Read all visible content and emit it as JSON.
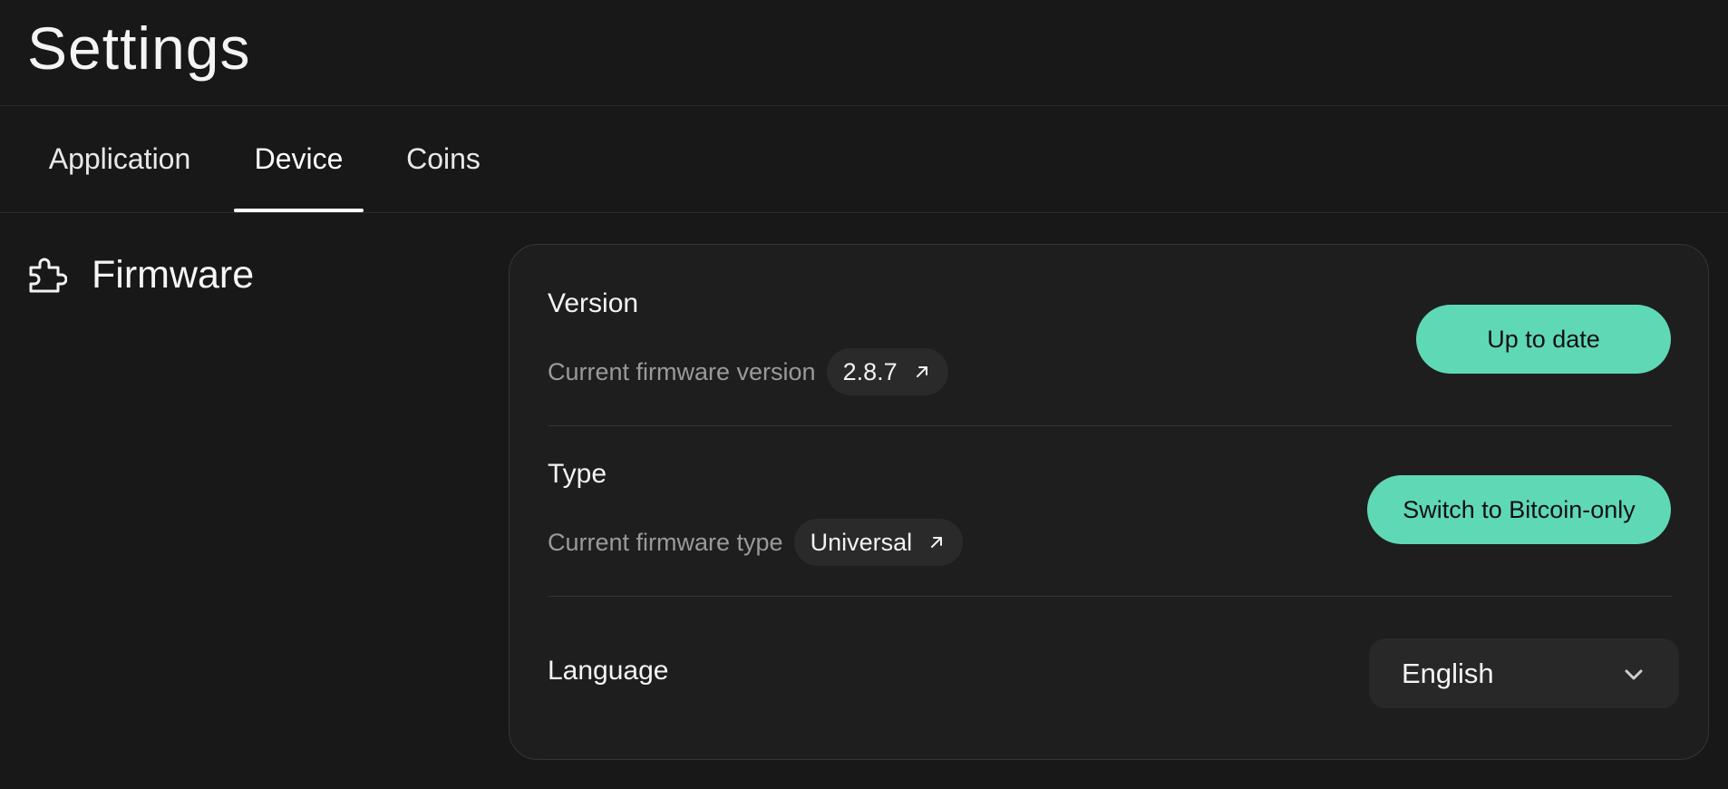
{
  "page": {
    "title": "Settings"
  },
  "tabs": [
    {
      "label": "Application",
      "active": false
    },
    {
      "label": "Device",
      "active": true
    },
    {
      "label": "Coins",
      "active": false
    }
  ],
  "section": {
    "icon": "puzzle-icon",
    "title": "Firmware"
  },
  "firmware": {
    "version": {
      "title": "Version",
      "label": "Current firmware version",
      "value": "2.8.7",
      "link_icon": "external-arrow-icon",
      "button_label": "Up to date"
    },
    "type": {
      "title": "Type",
      "label": "Current firmware type",
      "value": "Universal",
      "link_icon": "external-arrow-icon",
      "button_label": "Switch to Bitcoin-only"
    },
    "language": {
      "title": "Language",
      "selected": "English",
      "caret_icon": "chevron-down-icon"
    }
  },
  "colors": {
    "background": "#181818",
    "card": "#1e1e1e",
    "accent": "#5fd8b6",
    "muted_text": "#9a9a9a"
  }
}
